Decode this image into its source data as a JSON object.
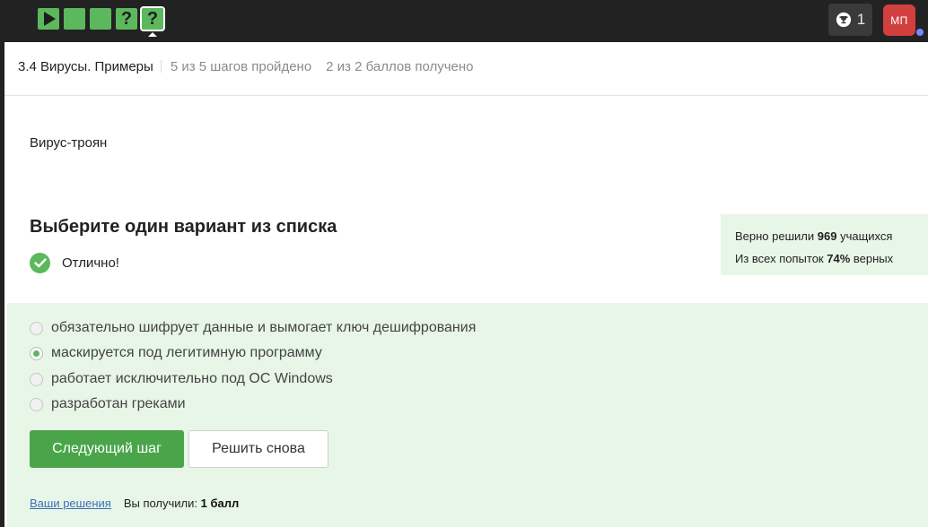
{
  "topbar": {
    "steps": [
      {
        "type": "play",
        "label": ""
      },
      {
        "type": "done",
        "label": ""
      },
      {
        "type": "done",
        "label": ""
      },
      {
        "type": "quiz",
        "label": "?"
      },
      {
        "type": "quiz-active",
        "label": "?"
      }
    ],
    "trophy_count": "1",
    "avatar_initials": "МП"
  },
  "lesson": {
    "title": "3.4 Вирусы. Примеры",
    "steps_progress": "5 из 5 шагов пройдено",
    "points_progress": "2 из 2 баллов  получено"
  },
  "step_text": "Вирус-троян",
  "quiz": {
    "title": "Выберите один вариант из списка",
    "status": "Отлично!",
    "stats": {
      "solved_prefix": "Верно решили ",
      "solved_count": "969",
      "solved_suffix": " учащихся",
      "attempts_prefix": "Из всех попыток ",
      "attempts_percent": "74%",
      "attempts_suffix": " верных"
    },
    "options": [
      {
        "label": "обязательно шифрует данные и вымогает ключ дешифрования",
        "checked": false
      },
      {
        "label": "маскируется под легитимную программу",
        "checked": true
      },
      {
        "label": "работает исключительно под ОС Windows",
        "checked": false
      },
      {
        "label": "разработан греками",
        "checked": false
      }
    ],
    "next_button": "Следующий шаг",
    "retry_button": "Решить снова",
    "solutions_link": "Ваши решения",
    "score_label": "Вы получили:",
    "score_value": "1 балл"
  },
  "colors": {
    "accent": "#5cb85c",
    "button_green": "#4aa54a",
    "panel_bg": "#e7f6e7",
    "topbar": "#222222",
    "avatar": "#d23f3f"
  }
}
